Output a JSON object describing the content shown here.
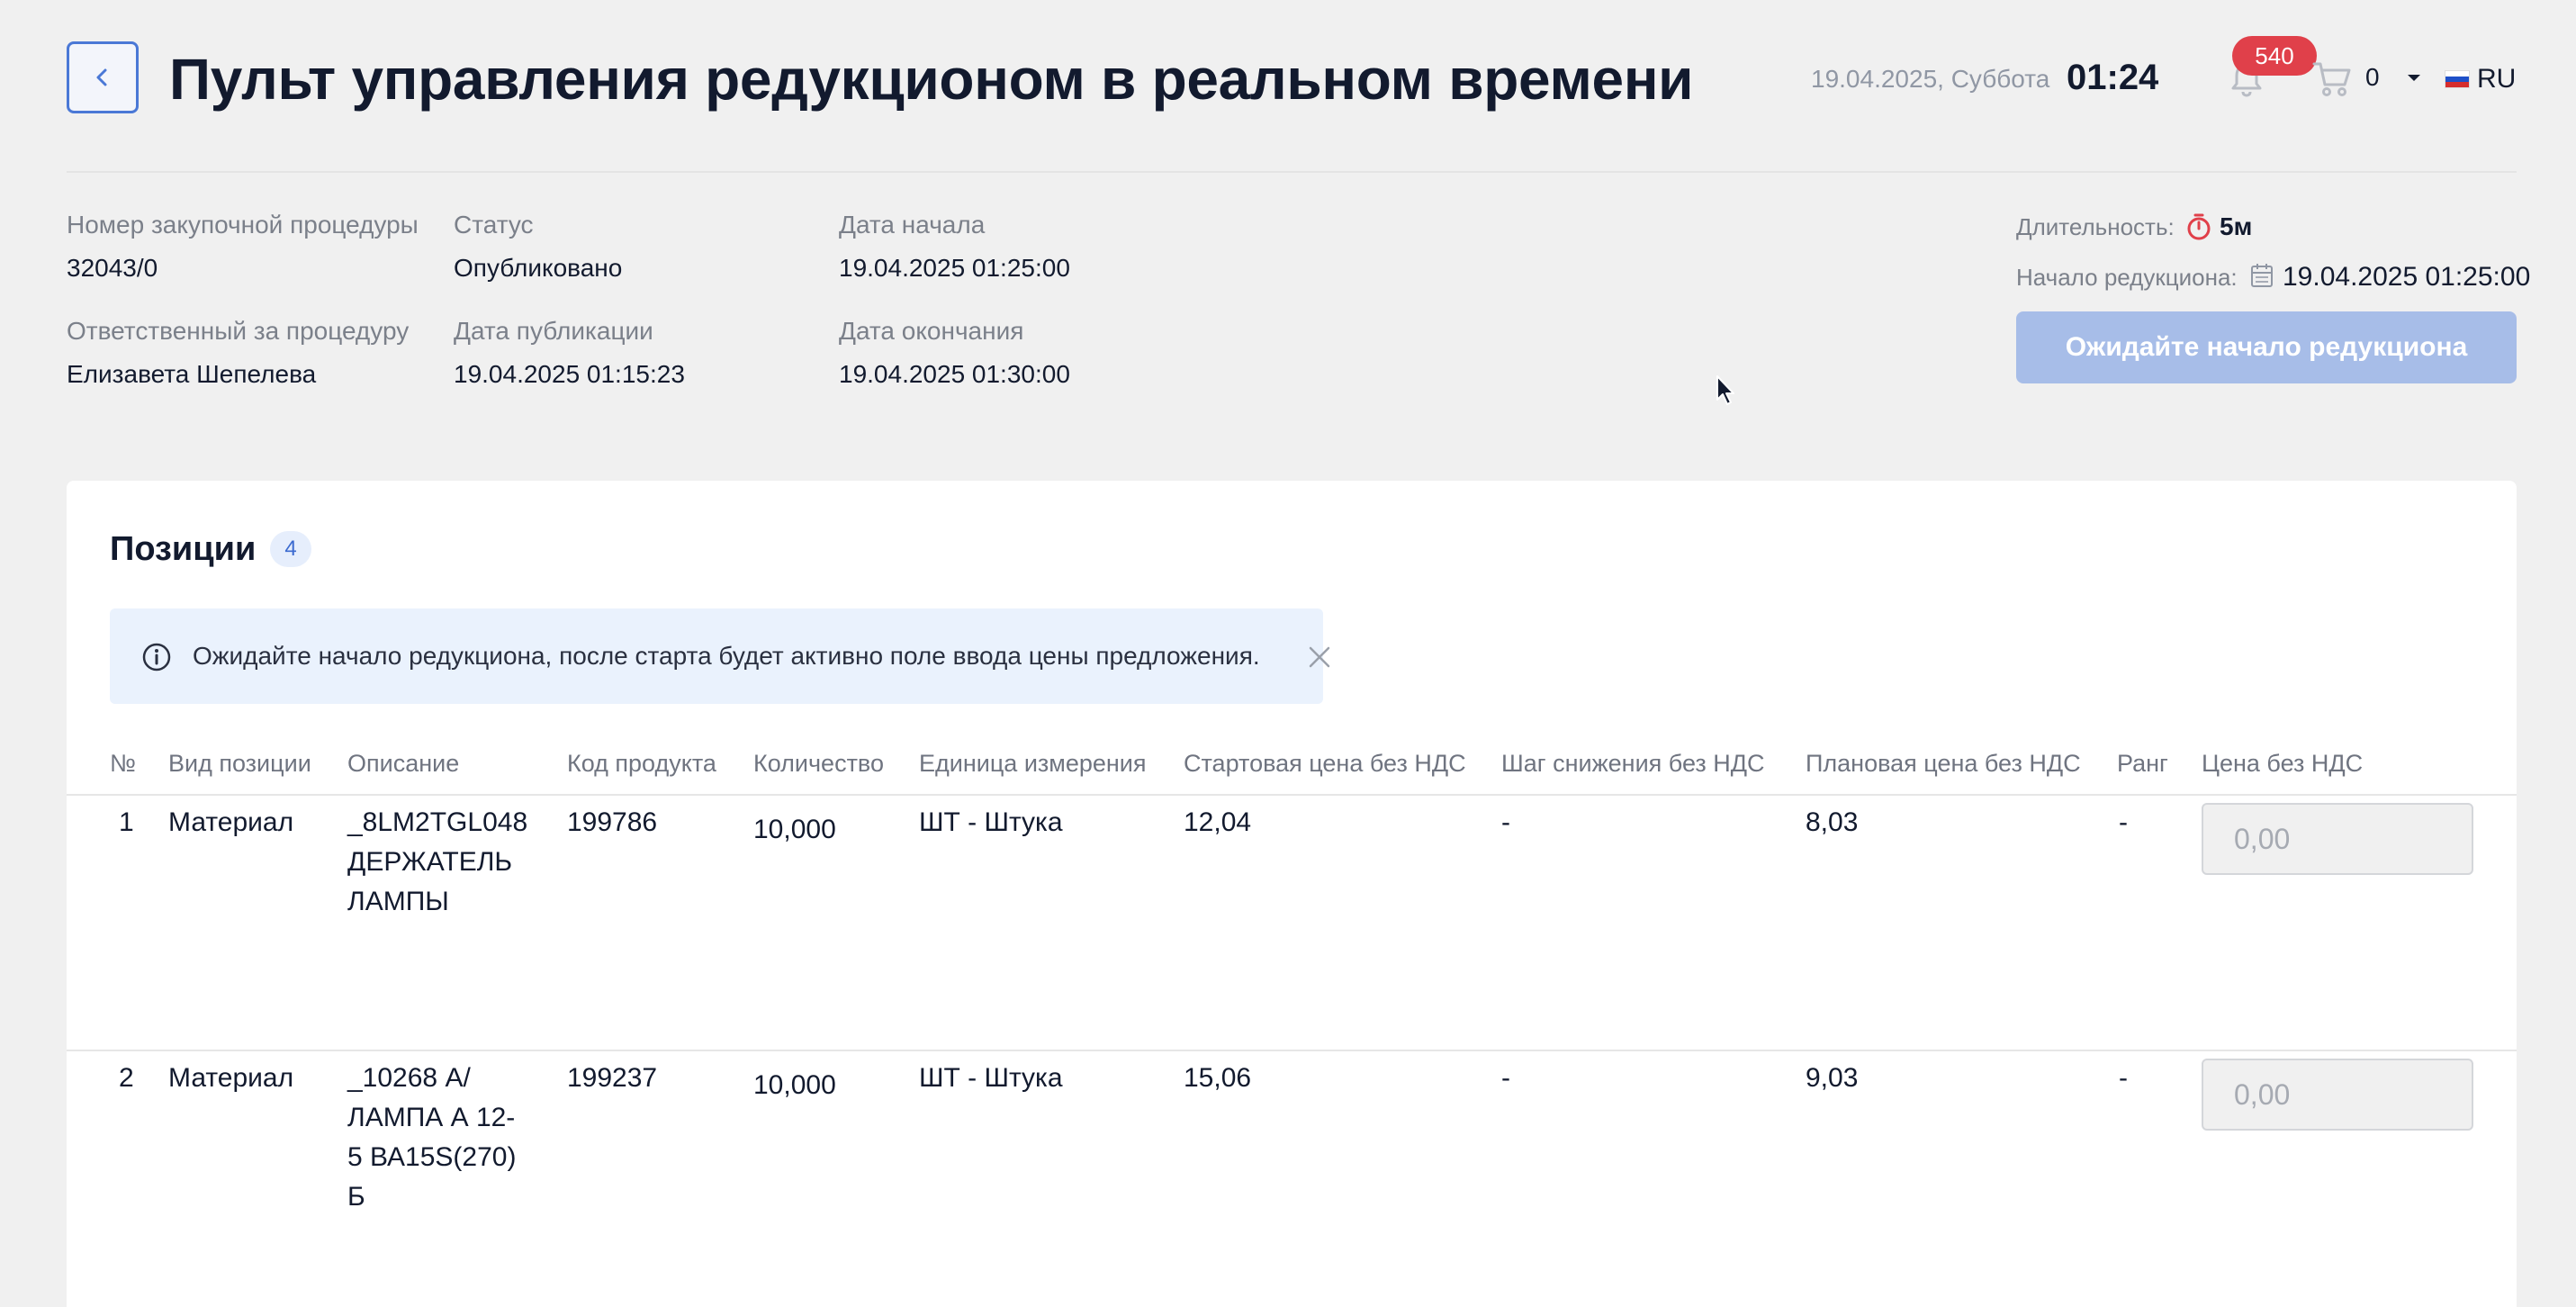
{
  "header": {
    "title": "Пульт управления редукционом в реальном времени",
    "date": "19.04.2025, Суббота",
    "time": "01:24",
    "notifications_count": "540",
    "cart_count": "0",
    "language": "RU"
  },
  "procedure": {
    "number_label": "Номер закупочной процедуры",
    "number_value": "32043/0",
    "responsible_label": "Ответственный за процедуру",
    "responsible_value": "Елизавета Шепелева",
    "status_label": "Статус",
    "status_value": "Опубликовано",
    "published_label": "Дата публикации",
    "published_value": "19.04.2025 01:15:23",
    "start_label": "Дата начала",
    "start_value": "19.04.2025 01:25:00",
    "end_label": "Дата окончания",
    "end_value": "19.04.2025 01:30:00"
  },
  "auction": {
    "duration_label": "Длительность:",
    "duration_value": "5м",
    "start_label": "Начало редукциона:",
    "start_value": "19.04.2025 01:25:00",
    "wait_button": "Ожидайте начало редукциона"
  },
  "positions": {
    "title": "Позиции",
    "count": "4",
    "alert_text": "Ожидайте начало редукциона, после старта будет активно поле ввода цены предложения.",
    "columns": [
      "№",
      "Вид позиции",
      "Описание",
      "Код продукта",
      "Количество",
      "Единица измерения",
      "Стартовая цена без НДС",
      "Шаг снижения без НДС",
      "Плановая цена без НДС",
      "Ранг",
      "Цена без НДС"
    ],
    "rows": [
      {
        "num": "1",
        "type": "Материал",
        "description": [
          "_8LM2TGL048",
          "ДЕРЖАТЕЛЬ",
          "ЛАМПЫ"
        ],
        "code": "199786",
        "quantity": "10,000",
        "unit": "ШТ - Штука",
        "start_price": "12,04",
        "step": "-",
        "planned_price": "8,03",
        "rank": "-",
        "price_placeholder": "0,00"
      },
      {
        "num": "2",
        "type": "Материал",
        "description": [
          "_10268 А/",
          "ЛАМПА А 12-",
          "5 ВА15S(270)",
          "Б"
        ],
        "code": "199237",
        "quantity": "10,000",
        "unit": "ШТ - Штука",
        "start_price": "15,06",
        "step": "-",
        "planned_price": "9,03",
        "rank": "-",
        "price_placeholder": "0,00"
      }
    ]
  },
  "colors": {
    "accent": "#4a78d6",
    "badge": "#e0404a",
    "disabled_button": "#a7bde8",
    "alert_bg": "#eaf2fd"
  }
}
